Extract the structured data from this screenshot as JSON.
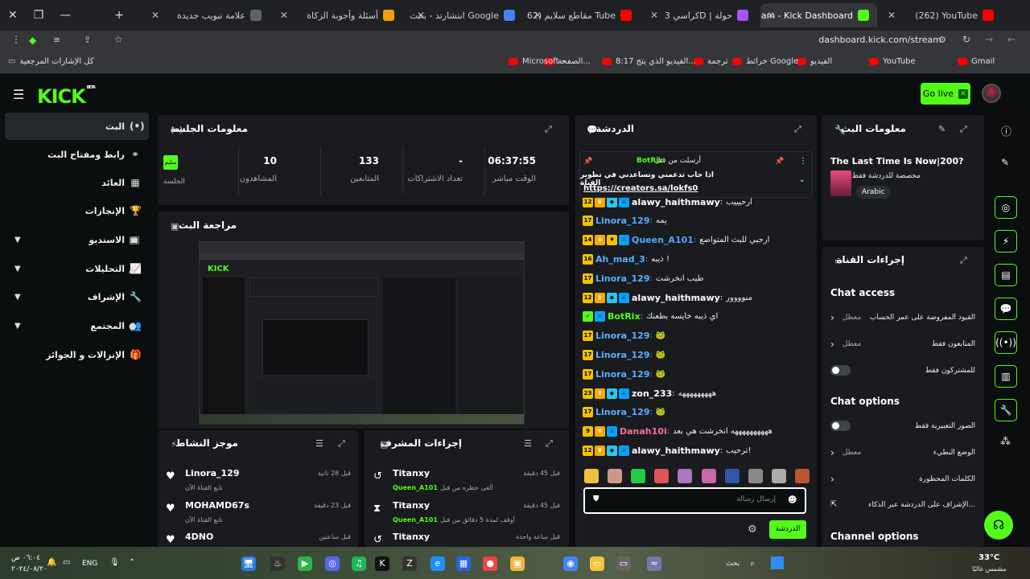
{
  "browser": {
    "tabs": [
      {
        "title": "علامة تبويب جديدة",
        "fav_color": "#5f6368"
      },
      {
        "title": "أسئلة وأجوبة الزكاة",
        "fav_color": "#f59e0b"
      },
      {
        "title": "انتشارتد - بحث Google",
        "fav_color": "#4285f4"
      },
      {
        "title": "(262) مقاطع سلايم Tube",
        "fav_color": "#ff0000"
      },
      {
        "title": "كراسي 3D | حولة",
        "fav_color": "#a855f7"
      },
      {
        "title": "Stream - Kick Dashboard",
        "fav_color": "#53fc18"
      },
      {
        "title": "(262) YouTube",
        "fav_color": "#ff0000"
      }
    ],
    "url": "dashboard.kick.com/stream",
    "bookmarks": [
      "Gmail",
      "YouTube",
      "الفيديو",
      "خرائط Google",
      "ترجمة",
      "8:17 الفيديو الذي يتج...",
      "الصفحة...",
      "Microsoft –",
      "كل الإشارات المرجعية"
    ]
  },
  "header": {
    "logo": "KICK",
    "beta": "BETA",
    "go_live": "Go live"
  },
  "nav": [
    {
      "label": "البث",
      "icon": "(•)",
      "active": true
    },
    {
      "label": "رابط ومفتاح البث",
      "icon": "⚭"
    },
    {
      "label": "العائد",
      "icon": "▦"
    },
    {
      "label": "الإنجازات",
      "icon": "🏆"
    },
    {
      "label": "الاستديو",
      "icon": "▣",
      "expand": true
    },
    {
      "label": "التحليلات",
      "icon": "📈",
      "expand": true
    },
    {
      "label": "الإشراف",
      "icon": "🔧",
      "expand": true
    },
    {
      "label": "المجتمع",
      "icon": "👥",
      "expand": true
    },
    {
      "label": "الإنزالات و الجوائز",
      "icon": "🎁"
    }
  ],
  "session": {
    "title": "معلومات الجلسة",
    "stats": [
      {
        "value": "06:37:55",
        "label": "الوقت مباشر"
      },
      {
        "value": "-",
        "label": "تعداد الاشتراكات"
      },
      {
        "value": "133",
        "label": "المتابعين"
      },
      {
        "value": "10",
        "label": "المشاهدون"
      }
    ],
    "session_label": "الجلسة",
    "badge": "سليم"
  },
  "preview": {
    "title": "مراجعة البث"
  },
  "activity": {
    "title": "موجز النشاط",
    "items": [
      {
        "name": "Linora_129",
        "sub": "تابع القناة الآن",
        "time": "قبل 28 ثانية"
      },
      {
        "name": "MOHAMD67s",
        "sub": "تابع القناة الآن",
        "time": "قبل 23 دقيقة"
      },
      {
        "name": "4DNO",
        "sub": "",
        "time": "قبل ساعتين"
      }
    ]
  },
  "modactions": {
    "title": "إجراءات المشرف",
    "items": [
      {
        "name": "Titanxy",
        "sub": "ألغى حظره من قبل",
        "mod": "Queen_A101",
        "time": "قبل 45 دقيقة"
      },
      {
        "name": "Titanxy",
        "sub": "أوقف لمدة 5 دقائق من قبل",
        "mod": "Queen_A101",
        "time": "قبل 45 دقيقة"
      },
      {
        "name": "Titanxy",
        "sub": "",
        "mod": "",
        "time": "قبل ساعة واحدة"
      }
    ]
  },
  "chat": {
    "title": "الدردشة",
    "pinned": {
      "by": "BotRix",
      "label": "أرسلت من قبل",
      "text": "اذا حاب تدعمني وتساعدني في تطوير القناة",
      "link": "https://creators.sa/lokfs0"
    },
    "messages": [
      {
        "user": "alawy_haithmawy",
        "color": "#fff",
        "badges": [
          "12",
          "crown",
          "vip",
          "mod"
        ],
        "text": "ارحيييب"
      },
      {
        "user": "Linora_129",
        "color": "#5ab0ff",
        "badges": [
          "17"
        ],
        "text": "يمه"
      },
      {
        "user": "Queen_A101",
        "color": "#53a8ff",
        "badges": [
          "14",
          "crown",
          "sub",
          "mod"
        ],
        "text": "ارحبي للبث المتواضع"
      },
      {
        "user": "Ah_mad_3",
        "color": "#5ab0ff",
        "badges": [
          "16"
        ],
        "text": "ذيبه !"
      },
      {
        "user": "Linora_129",
        "color": "#5ab0ff",
        "badges": [
          "17"
        ],
        "text": "طيب انخرشت"
      },
      {
        "user": "alawy_haithmawy",
        "color": "#fff",
        "badges": [
          "12",
          "crown",
          "vip",
          "mod"
        ],
        "text": "منوووور"
      },
      {
        "user": "BotRix",
        "color": "#53fc18",
        "badges": [
          "bot",
          "mod"
        ],
        "text": "اي ذيبه خايسه بطعنك"
      },
      {
        "user": "Linora_129",
        "color": "#5ab0ff",
        "badges": [
          "17"
        ],
        "text": "🐸"
      },
      {
        "user": "Linora_129",
        "color": "#5ab0ff",
        "badges": [
          "17"
        ],
        "text": "🐸"
      },
      {
        "user": "Linora_129",
        "color": "#5ab0ff",
        "badges": [
          "17"
        ],
        "text": "🐸"
      },
      {
        "user": "zon_233",
        "color": "#fff",
        "badges": [
          "23",
          "crown",
          "vip",
          "mod"
        ],
        "text": "هههههههههه"
      },
      {
        "user": "Linora_129",
        "color": "#5ab0ff",
        "badges": [
          "17"
        ],
        "text": "🐸"
      },
      {
        "user": "Danah10i",
        "color": "#ff6b9a",
        "badges": [
          "9",
          "crown",
          "mod"
        ],
        "text": "ههههههههههه انخرشت هي بعد"
      },
      {
        "user": "alawy_haithmawy",
        "color": "#fff",
        "badges": [
          "12",
          "crown",
          "vip",
          "mod"
        ],
        "text": "ترحيب!"
      }
    ],
    "input_placeholder": "إرسال رسالة",
    "send": "الدردشة"
  },
  "streaminfo": {
    "title": "معلومات البث",
    "stream_title": "The Last Time Is Now|200?",
    "subtitle": "مخصصة للدردشة فقط",
    "language": "Arabic"
  },
  "channel": {
    "title": "إجراءات القناة",
    "chat_access": "Chat access",
    "access_rows": [
      {
        "label": "القيود المفروضة على عمر الحساب",
        "value": "معطل",
        "type": "chevron"
      },
      {
        "label": "المتابعون فقط",
        "value": "معطل",
        "type": "chevron"
      },
      {
        "label": "للمشتركون فقط",
        "value": "",
        "type": "toggle"
      }
    ],
    "chat_options": "Chat options",
    "option_rows": [
      {
        "label": "الصور التعبيرية فقط",
        "value": "",
        "type": "toggle"
      },
      {
        "label": "الوضع البطيء",
        "value": "معطل",
        "type": "chevron"
      },
      {
        "label": "الكلمات المحظورة",
        "value": "",
        "type": "chevron"
      },
      {
        "label": "الإشراف على الدردشة عبر الذكاء...",
        "value": "",
        "type": "ext"
      }
    ],
    "channel_options": "Channel options"
  },
  "taskbar": {
    "weather": "33°C",
    "weather_sub": "مشمس غالبًا",
    "lang": "ENG",
    "time": "٠٦:٠٤ ص",
    "date": "٢٠٢٤/٠٨/٢٠",
    "search": "بحث"
  },
  "colors": {
    "accent": "#53fc18",
    "panel": "#191b1f",
    "bg": "#0b0e0f"
  }
}
